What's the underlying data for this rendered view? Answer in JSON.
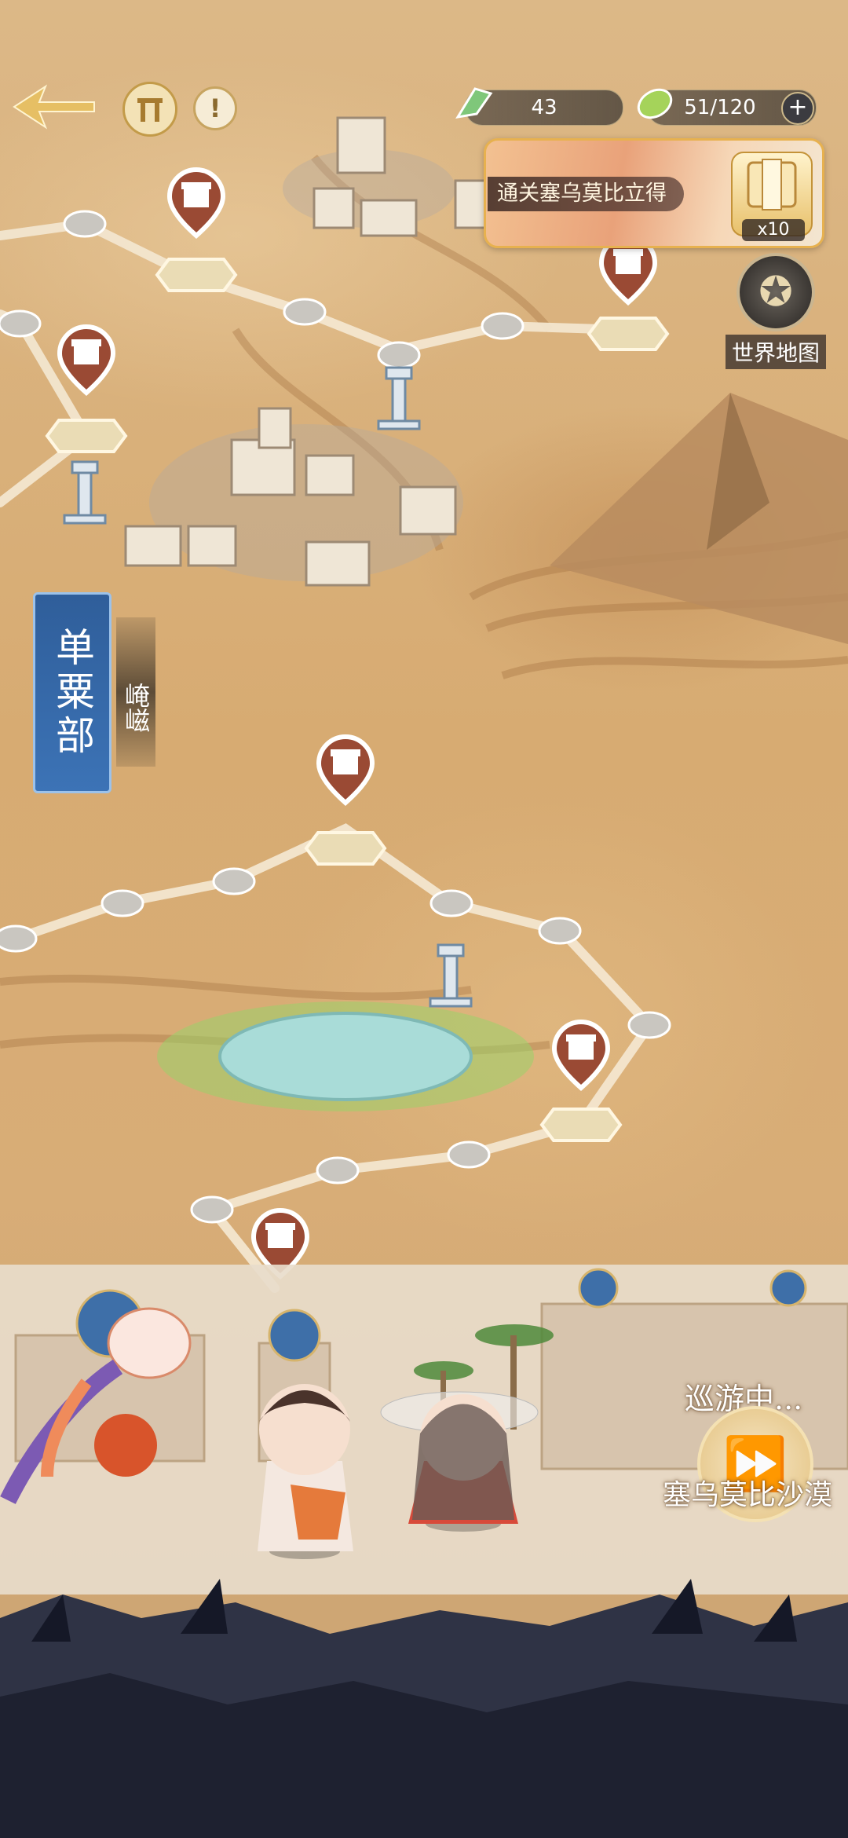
{
  "hud": {
    "back_icon": "arrow-back-icon",
    "gate_icon": "gate-icon",
    "info_icon": "info-icon",
    "feather_icon": "feather-icon",
    "feather_count": "43",
    "leaf_icon": "leaf-icon",
    "stamina": "51/120",
    "add_label": "+"
  },
  "banner": {
    "label": "通关塞乌莫比立得",
    "reward_count": "x10"
  },
  "world_map": {
    "label": "世界地图",
    "icon": "world-map-icon"
  },
  "region": {
    "name": "单粟部",
    "sub": "崦嵫"
  },
  "roaming": {
    "status": "巡游中...",
    "place": "塞乌莫比沙漠",
    "icon": "fast-forward-icon"
  },
  "colors": {
    "sand": "#d8ad77",
    "path": "#f3e6cf",
    "gift_badge": "#9a4a34",
    "region_blue": "#3c73b6",
    "oasis": "#9fd6d3"
  }
}
